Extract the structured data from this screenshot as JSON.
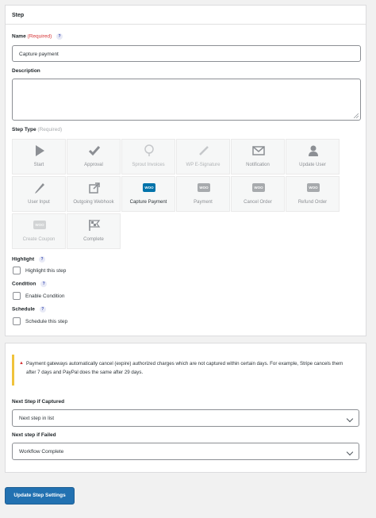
{
  "panel_step": {
    "title": "Step",
    "name_label": "Name",
    "name_required": "(Required)",
    "name_help": "?",
    "name_value": "Capture payment",
    "description_label": "Description",
    "description_value": "",
    "step_type_label": "Step Type",
    "step_type_required": "(Required)",
    "step_types": [
      {
        "label": "Start",
        "icon": "play-icon"
      },
      {
        "label": "Approval",
        "icon": "checkmark-icon"
      },
      {
        "label": "Sprout Invoices",
        "icon": "sprout-icon"
      },
      {
        "label": "WP E-Signature",
        "icon": "pen-icon"
      },
      {
        "label": "Notification",
        "icon": "envelope-icon"
      },
      {
        "label": "Update User",
        "icon": "user-icon"
      },
      {
        "label": "User Input",
        "icon": "pencil-icon"
      },
      {
        "label": "Outgoing Webhook",
        "icon": "external-link-icon"
      },
      {
        "label": "Capture Payment",
        "icon": "woo-icon",
        "woo": "WOO"
      },
      {
        "label": "Payment",
        "icon": "woo-icon",
        "woo": "WOO"
      },
      {
        "label": "Cancel Order",
        "icon": "woo-icon",
        "woo": "WOO"
      },
      {
        "label": "Refund Order",
        "icon": "woo-icon",
        "woo": "WOO"
      },
      {
        "label": "Create Coupon",
        "icon": "woo-icon",
        "woo": "WOO"
      },
      {
        "label": "Complete",
        "icon": "flag-icon"
      }
    ],
    "selected_step_type": "Capture Payment",
    "highlight_label": "Highlight",
    "highlight_help": "?",
    "highlight_checkbox": "Highlight this step",
    "condition_label": "Condition",
    "condition_help": "?",
    "condition_checkbox": "Enable Condition",
    "schedule_label": "Schedule",
    "schedule_help": "?",
    "schedule_checkbox": "Schedule this step"
  },
  "panel_next": {
    "notice_icon": "warning-icon",
    "notice_text": "Payment gateways automatically cancel (expire) authorized charges which are not captured within certain days. For example, Stripe cancels them after 7 days and PayPal does the same after 29 days.",
    "next_captured_label": "Next Step if Captured",
    "next_captured_value": "Next step in list",
    "next_failed_label": "Next step if Failed",
    "next_failed_value": "Workflow Complete"
  },
  "update_button": "Update Step Settings",
  "colors": {
    "accent": "#2271b1",
    "required": "#d63638",
    "notice_border": "#f0c33c",
    "woo_active": "#0073aa"
  }
}
